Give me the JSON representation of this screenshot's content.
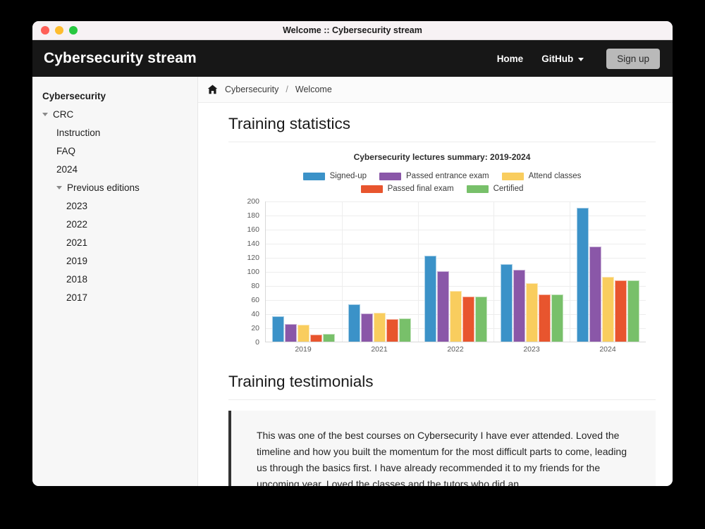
{
  "window": {
    "title": "Welcome :: Cybersecurity stream",
    "traffic_lights": [
      "close-button",
      "minimize-button",
      "maximize-button"
    ]
  },
  "header": {
    "brand": "Cybersecurity stream",
    "nav": [
      {
        "label": "Home",
        "has_caret": false
      },
      {
        "label": "GitHub",
        "has_caret": true
      }
    ],
    "signup_label": "Sign up"
  },
  "sidebar": {
    "items": [
      {
        "label": "Cybersecurity",
        "level": "root",
        "arrow": false
      },
      {
        "label": "CRC",
        "level": "lvl1",
        "arrow": true
      },
      {
        "label": "Instruction",
        "level": "lvl2",
        "arrow": false
      },
      {
        "label": "FAQ",
        "level": "lvl2",
        "arrow": false
      },
      {
        "label": "2024",
        "level": "lvl2",
        "arrow": false
      },
      {
        "label": "Previous editions",
        "level": "lvl2",
        "arrow": true
      },
      {
        "label": "2023",
        "level": "lvl3",
        "arrow": false
      },
      {
        "label": "2022",
        "level": "lvl3",
        "arrow": false
      },
      {
        "label": "2021",
        "level": "lvl3",
        "arrow": false
      },
      {
        "label": "2019",
        "level": "lvl3",
        "arrow": false
      },
      {
        "label": "2018",
        "level": "lvl3",
        "arrow": false
      },
      {
        "label": "2017",
        "level": "lvl3",
        "arrow": false
      }
    ]
  },
  "breadcrumb": {
    "home_icon": "home-icon",
    "items": [
      "Cybersecurity",
      "Welcome"
    ],
    "separator": "/"
  },
  "main": {
    "statistics_heading": "Training statistics",
    "testimonials_heading": "Training testimonials",
    "testimonial": "This was one of the best courses on Cybersecurity I have ever attended. Loved the timeline and how you built the momentum for the most difficult parts to come, leading us through the basics first. I have already recommended it to my friends for the upcoming year. Loved the classes and the tutors who did an"
  },
  "chart_data": {
    "type": "bar",
    "title": "Cybersecurity lectures summary: 2019-2024",
    "xlabel": "",
    "ylabel": "",
    "ylim": [
      0,
      200
    ],
    "yticks": [
      0,
      20,
      40,
      60,
      80,
      100,
      120,
      140,
      160,
      180,
      200
    ],
    "grid": true,
    "legend_position": "top",
    "categories": [
      "2019",
      "2021",
      "2022",
      "2023",
      "2024"
    ],
    "series": [
      {
        "name": "Signed-up",
        "color": "#3b92c8",
        "values": [
          36,
          53,
          122,
          110,
          190
        ]
      },
      {
        "name": "Passed entrance exam",
        "color": "#8a57a8",
        "values": [
          25,
          40,
          100,
          102,
          135
        ]
      },
      {
        "name": "Attend classes",
        "color": "#f9cd5e",
        "values": [
          24,
          41,
          72,
          83,
          92
        ]
      },
      {
        "name": "Passed final exam",
        "color": "#e8552e",
        "values": [
          10,
          32,
          64,
          67,
          87
        ]
      },
      {
        "name": "Certified",
        "color": "#78c06a",
        "values": [
          11,
          33,
          64,
          67,
          87
        ]
      }
    ]
  }
}
